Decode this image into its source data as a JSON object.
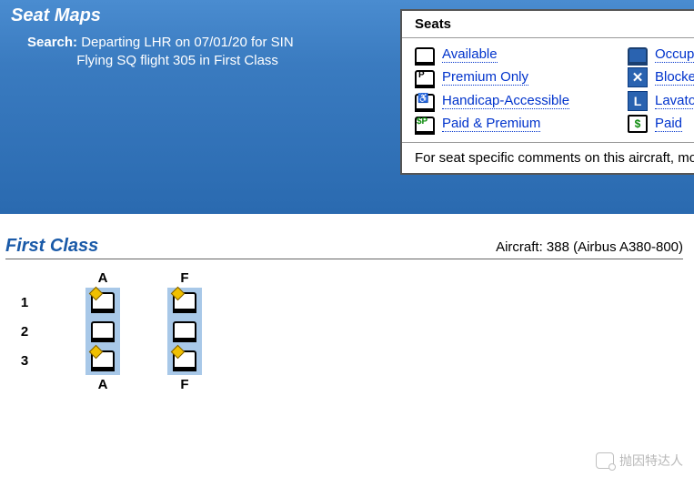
{
  "header": {
    "title": "Seat Maps",
    "search_label": "Search:",
    "search_line1": "Departing LHR on 07/01/20 for SIN",
    "search_line2": "Flying SQ flight 305 in First Class"
  },
  "legend": {
    "title": "Seats",
    "items": [
      {
        "label": "Available"
      },
      {
        "label": "Occupied"
      },
      {
        "label": "Premium Only"
      },
      {
        "label": "Blocked"
      },
      {
        "label": "Handicap-Accessible"
      },
      {
        "label": "Lavatory"
      },
      {
        "label": "Paid & Premium"
      },
      {
        "label": "Paid"
      }
    ],
    "note": "For seat specific comments on this aircraft, mou"
  },
  "cabin": {
    "class_name": "First Class",
    "aircraft": "Aircraft: 388 (Airbus A380-800)",
    "columns": [
      "A",
      "F"
    ],
    "rows": [
      "1",
      "2",
      "3"
    ]
  },
  "watermark": "抛因特达人"
}
